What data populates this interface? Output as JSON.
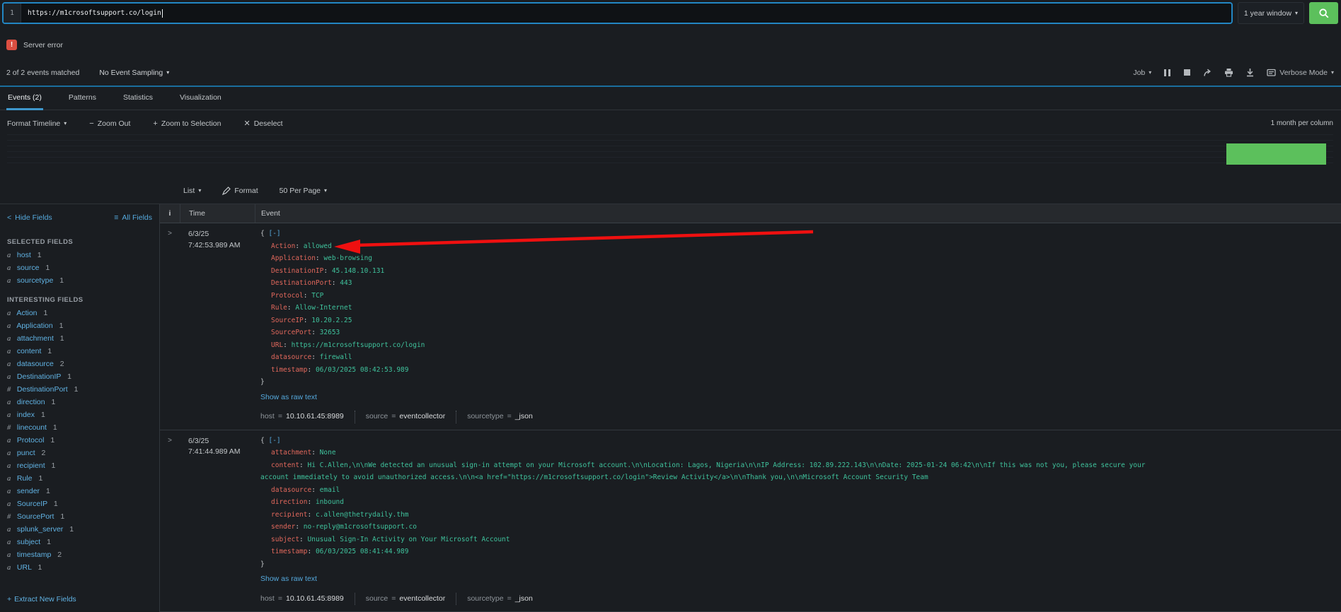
{
  "colors": {
    "accent_blue": "#2286c3",
    "link_blue": "#55a9dd",
    "green": "#5cc05c",
    "error_red": "#dc4e41",
    "json_key": "#e2685c",
    "json_value": "#3fc29c",
    "arrow_red": "#ef1010"
  },
  "search": {
    "line_number": "1",
    "query": "https://m1crosoftsupport.co/login",
    "time_range": "1 year window"
  },
  "alert": {
    "label": "Server error"
  },
  "job_bar": {
    "matched": "2 of 2 events matched",
    "sampling": "No Event Sampling",
    "job": "Job",
    "verbose": "Verbose Mode"
  },
  "tabs": [
    {
      "label": "Events (2)",
      "active": true
    },
    {
      "label": "Patterns",
      "active": false
    },
    {
      "label": "Statistics",
      "active": false
    },
    {
      "label": "Visualization",
      "active": false
    }
  ],
  "timeline": {
    "format_label": "Format Timeline",
    "zoom_out": "Zoom Out",
    "zoom_selection": "Zoom to Selection",
    "deselect": "Deselect",
    "scale": "1 month per column"
  },
  "toolbar": {
    "list": "List",
    "format": "Format",
    "per_page": "50 Per Page"
  },
  "sidebar": {
    "hide": "Hide Fields",
    "all": "All Fields",
    "selected_header": "SELECTED FIELDS",
    "selected_fields": [
      {
        "type": "a",
        "name": "host",
        "count": "1"
      },
      {
        "type": "a",
        "name": "source",
        "count": "1"
      },
      {
        "type": "a",
        "name": "sourcetype",
        "count": "1"
      }
    ],
    "interesting_header": "INTERESTING FIELDS",
    "interesting_fields": [
      {
        "type": "a",
        "name": "Action",
        "count": "1"
      },
      {
        "type": "a",
        "name": "Application",
        "count": "1"
      },
      {
        "type": "a",
        "name": "attachment",
        "count": "1"
      },
      {
        "type": "a",
        "name": "content",
        "count": "1"
      },
      {
        "type": "a",
        "name": "datasource",
        "count": "2"
      },
      {
        "type": "a",
        "name": "DestinationIP",
        "count": "1"
      },
      {
        "type": "#",
        "name": "DestinationPort",
        "count": "1"
      },
      {
        "type": "a",
        "name": "direction",
        "count": "1"
      },
      {
        "type": "a",
        "name": "index",
        "count": "1"
      },
      {
        "type": "#",
        "name": "linecount",
        "count": "1"
      },
      {
        "type": "a",
        "name": "Protocol",
        "count": "1"
      },
      {
        "type": "a",
        "name": "punct",
        "count": "2"
      },
      {
        "type": "a",
        "name": "recipient",
        "count": "1"
      },
      {
        "type": "a",
        "name": "Rule",
        "count": "1"
      },
      {
        "type": "a",
        "name": "sender",
        "count": "1"
      },
      {
        "type": "a",
        "name": "SourceIP",
        "count": "1"
      },
      {
        "type": "#",
        "name": "SourcePort",
        "count": "1"
      },
      {
        "type": "a",
        "name": "splunk_server",
        "count": "1"
      },
      {
        "type": "a",
        "name": "subject",
        "count": "1"
      },
      {
        "type": "a",
        "name": "timestamp",
        "count": "2"
      },
      {
        "type": "a",
        "name": "URL",
        "count": "1"
      }
    ],
    "extract": "Extract New Fields"
  },
  "table": {
    "headers": {
      "info": "i",
      "time": "Time",
      "event": "Event"
    },
    "syntax": {
      "open": "{",
      "collapse": "[-]",
      "close": "}",
      "colon": ":",
      "eq": "="
    },
    "events": [
      {
        "date": "6/3/25",
        "time": "7:42:53.989 AM",
        "fields": [
          {
            "key": "Action",
            "value": "allowed"
          },
          {
            "key": "Application",
            "value": "web-browsing"
          },
          {
            "key": "DestinationIP",
            "value": "45.148.10.131"
          },
          {
            "key": "DestinationPort",
            "value": "443"
          },
          {
            "key": "Protocol",
            "value": "TCP"
          },
          {
            "key": "Rule",
            "value": "Allow-Internet"
          },
          {
            "key": "SourceIP",
            "value": "10.20.2.25"
          },
          {
            "key": "SourcePort",
            "value": "32653"
          },
          {
            "key": "URL",
            "value": "https://m1crosoftsupport.co/login"
          },
          {
            "key": "datasource",
            "value": "firewall"
          },
          {
            "key": "timestamp",
            "value": "06/03/2025 08:42:53.989"
          }
        ],
        "raw_link": "Show as raw text",
        "meta": [
          {
            "label": "host",
            "value": "10.10.61.45:8989"
          },
          {
            "label": "source",
            "value": "eventcollector"
          },
          {
            "label": "sourcetype",
            "value": "_json"
          }
        ]
      },
      {
        "date": "6/3/25",
        "time": "7:41:44.989 AM",
        "fields": [
          {
            "key": "attachment",
            "value": "None"
          },
          {
            "key": "content",
            "value": "Hi C.Allen,\\n\\nWe detected an unusual sign-in attempt on your Microsoft account.\\n\\nLocation: Lagos, Nigeria\\n\\nIP Address: 102.89.222.143\\n\\nDate: 2025-01-24 06:42\\n\\nIf this was not you, please secure your account immediately to avoid unauthorized access.\\n\\n<a href=\"https://m1crosoftsupport.co/login\">Review Activity</a>\\n\\nThank you,\\n\\nMicrosoft Account Security Team"
          },
          {
            "key": "datasource",
            "value": "email"
          },
          {
            "key": "direction",
            "value": "inbound"
          },
          {
            "key": "recipient",
            "value": "c.allen@thetrydaily.thm"
          },
          {
            "key": "sender",
            "value": "no-reply@m1crosoftsupport.co"
          },
          {
            "key": "subject",
            "value": "Unusual Sign-In Activity on Your Microsoft Account"
          },
          {
            "key": "timestamp",
            "value": "06/03/2025 08:41:44.989"
          }
        ],
        "raw_link": "Show as raw text",
        "meta": [
          {
            "label": "host",
            "value": "10.10.61.45:8989"
          },
          {
            "label": "source",
            "value": "eventcollector"
          },
          {
            "label": "sourcetype",
            "value": "_json"
          }
        ]
      }
    ]
  }
}
